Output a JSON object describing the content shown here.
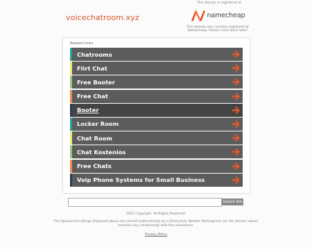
{
  "header": {
    "domain": "voicechatroom.xyz",
    "registered_at_label": "This domain is registered at",
    "brand_name": "namecheap",
    "brand_note": "This domain was recently registered at Namecheap. Please check back later!"
  },
  "related": {
    "label": "Related Links",
    "links": [
      {
        "label": "Chatrooms",
        "stripe": "#2a9d8f"
      },
      {
        "label": "Flirt Chat",
        "stripe": "#e9e97a"
      },
      {
        "label": "Free Booter",
        "stripe": "#98c77d"
      },
      {
        "label": "Free Chat",
        "stripe": "#ee8a4f"
      },
      {
        "label": "Booter",
        "stripe": "#2b3d50"
      },
      {
        "label": "Locker Room",
        "stripe": "#2a9d8f"
      },
      {
        "label": "Chat Room",
        "stripe": "#e9e97a"
      },
      {
        "label": "Chat Kostenlos",
        "stripe": "#98c77d"
      },
      {
        "label": "Free Chats",
        "stripe": "#ee8a4f"
      },
      {
        "label": "Voip Phone Systems for Small Business",
        "stripe": "#2b3d50"
      }
    ],
    "arrow_color": "#e8572c",
    "active_index": 4
  },
  "search": {
    "placeholder": "",
    "button_label": "Search Ads"
  },
  "footer": {
    "copyright": "2021 Copyright. All Rights Reserved.",
    "disclaimer": "The Sponsored Listings displayed above are served automatically by a third party. Neither Parkingcrew nor the domain owner maintain any relationship with the advertisers.",
    "privacy": "Privacy Policy"
  }
}
